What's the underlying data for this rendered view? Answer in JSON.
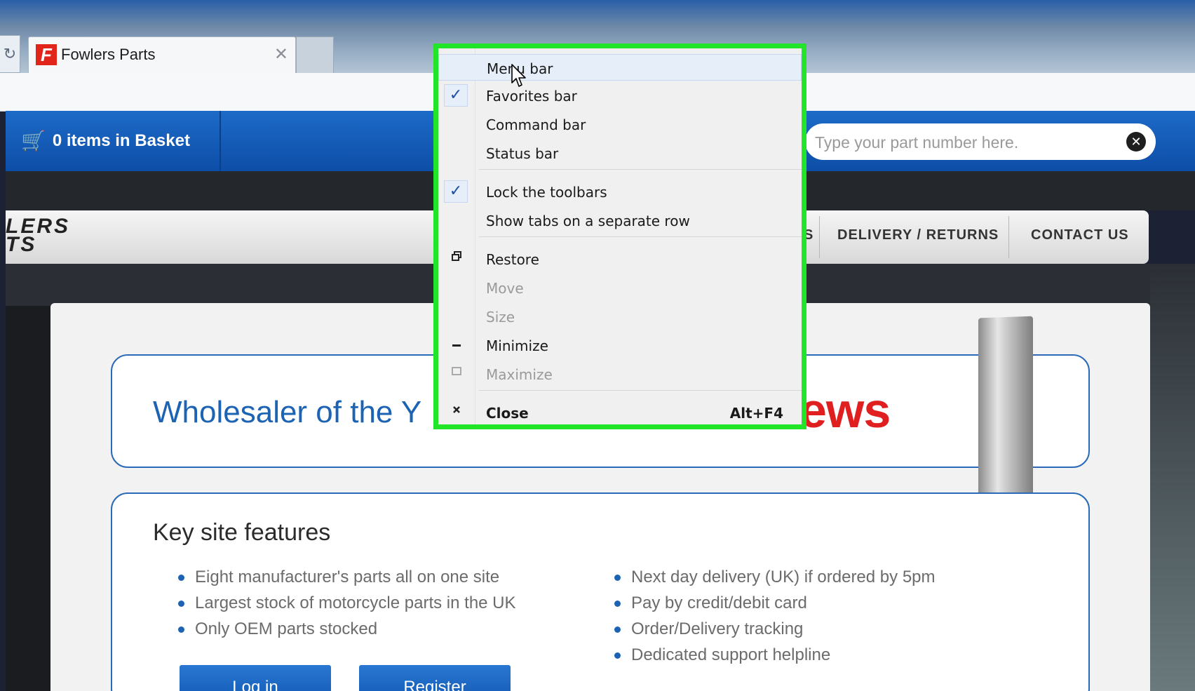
{
  "browser": {
    "tab_title": "Fowlers Parts",
    "tab_close": "✕",
    "back_glyph": "↻",
    "favicon_letter": "F"
  },
  "site": {
    "basket_text": "0 items in Basket",
    "search_placeholder": "Type your part number here.",
    "search_clear": "✕",
    "logo_line1": "LERS",
    "logo_line2": "TS",
    "nav": {
      "partial": "S",
      "delivery": "DELIVERY / RETURNS",
      "contact": "CONTACT US"
    },
    "banner": {
      "wholesaler": "Wholesaler of the Y",
      "news": "ews"
    },
    "features": {
      "title": "Key site features",
      "left": [
        "Eight manufacturer's parts all on one site",
        "Largest stock of motorcycle parts in the UK",
        "Only OEM parts stocked"
      ],
      "right": [
        "Next day delivery (UK) if ordered by 5pm",
        "Pay by credit/debit card",
        "Order/Delivery tracking",
        "Dedicated support helpline"
      ],
      "login_label": "Log in",
      "register_label": "Register"
    }
  },
  "context_menu": {
    "items": [
      {
        "label": "Menu bar"
      },
      {
        "label": "Favorites bar",
        "check": "✓"
      },
      {
        "label": "Command bar"
      },
      {
        "label": "Status bar"
      },
      {
        "label": "Lock the toolbars",
        "check": "✓"
      },
      {
        "label": "Show tabs on a separate row"
      },
      {
        "label": "Restore",
        "icon": "restore-icon"
      },
      {
        "label": "Move"
      },
      {
        "label": "Size"
      },
      {
        "label": "Minimize",
        "icon": "minimize-icon"
      },
      {
        "label": "Maximize",
        "icon": "maximize-icon"
      },
      {
        "label": "Close",
        "icon": "close-icon",
        "shortcut": "Alt+F4"
      }
    ]
  },
  "colors": {
    "highlight_border": "#22e52a",
    "site_blue": "#0d4ea7",
    "news_red": "#e02020"
  }
}
